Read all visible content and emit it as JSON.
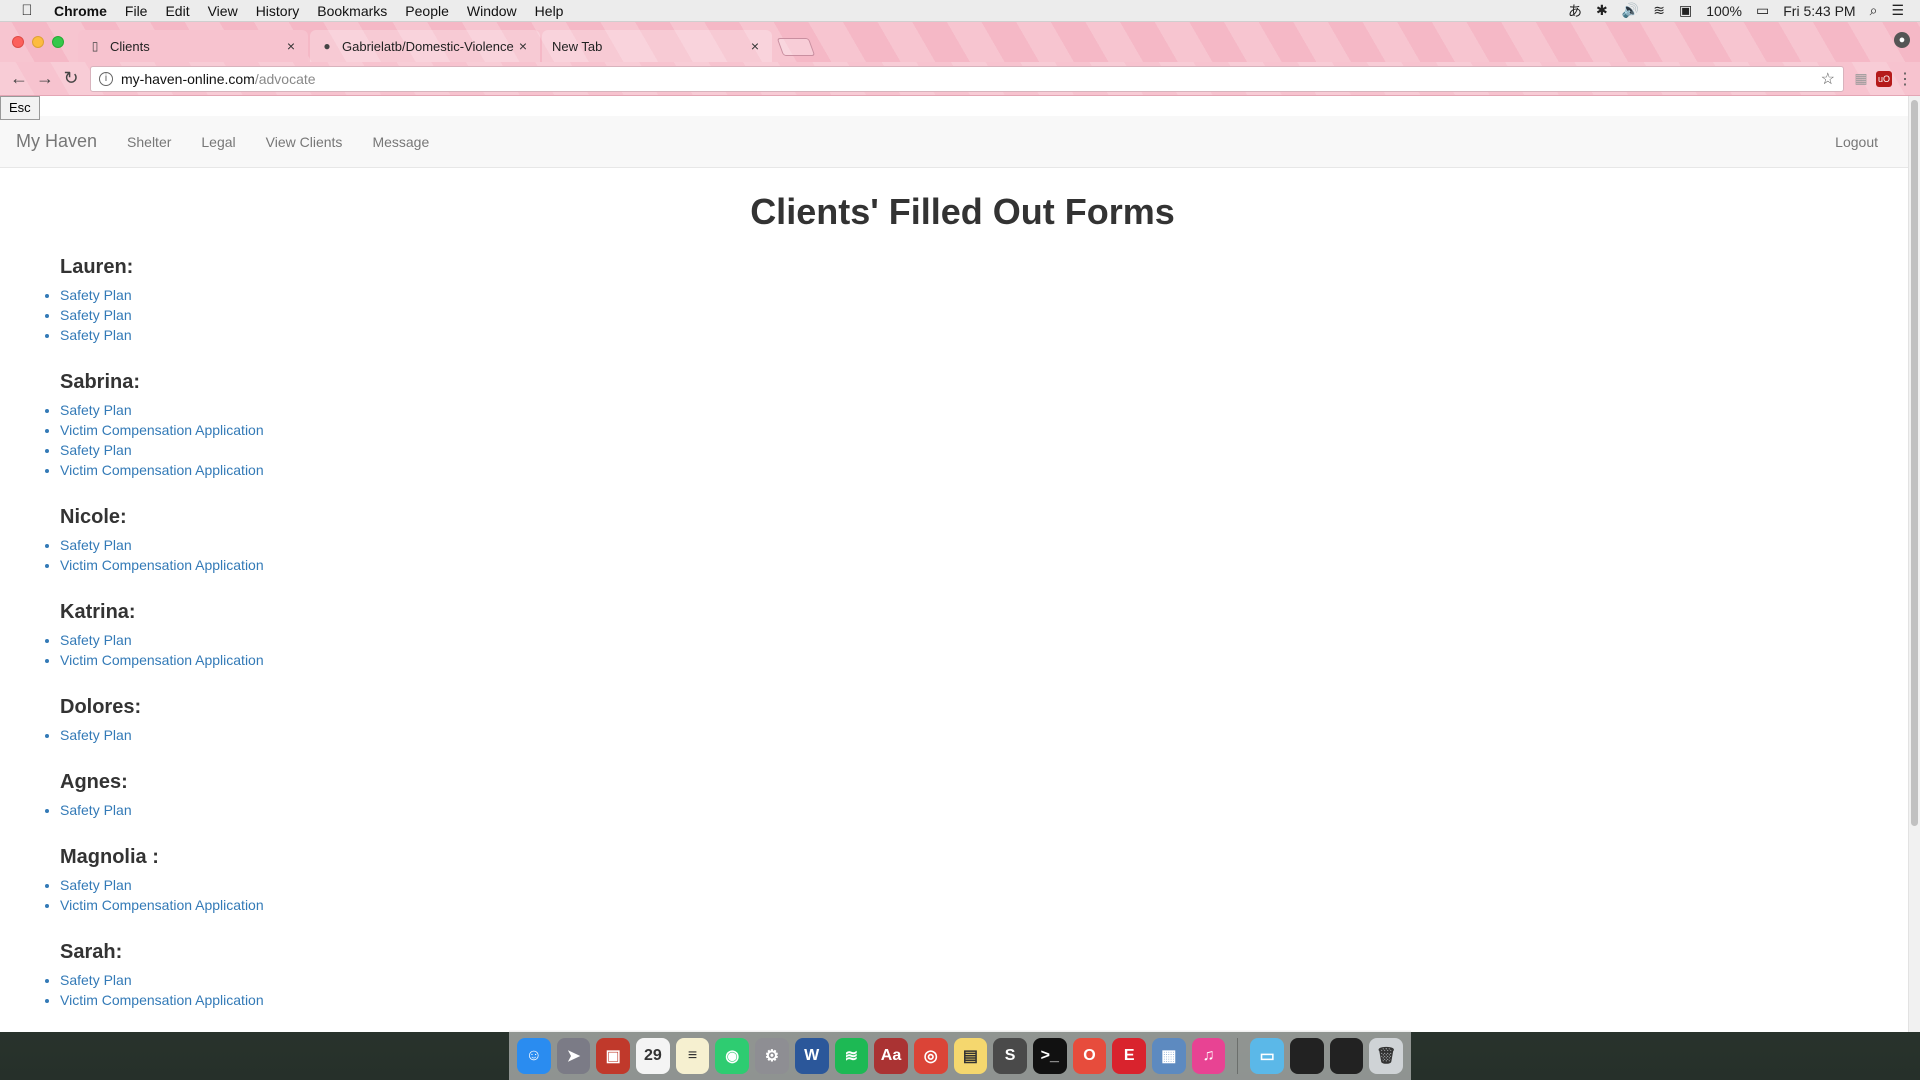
{
  "menubar": {
    "app": "Chrome",
    "items": [
      "File",
      "Edit",
      "View",
      "History",
      "Bookmarks",
      "People",
      "Window",
      "Help"
    ],
    "battery": "100%",
    "clock": "Fri 5:43 PM"
  },
  "browser": {
    "tabs": [
      {
        "title": "Clients",
        "favicon": "page-icon"
      },
      {
        "title": "Gabrielatb/Domestic-Violence",
        "favicon": "github-icon"
      },
      {
        "title": "New Tab",
        "favicon": ""
      }
    ],
    "url_host": "my-haven-online.com",
    "url_path": "/advocate"
  },
  "page": {
    "esc_label": "Esc",
    "brand": "My Haven",
    "nav": [
      "Shelter",
      "Legal",
      "View Clients",
      "Message"
    ],
    "logout": "Logout",
    "heading": "Clients' Filled Out Forms",
    "clients": [
      {
        "name": "Lauren:",
        "forms": [
          "Safety Plan",
          "Safety Plan",
          "Safety Plan"
        ]
      },
      {
        "name": "Sabrina:",
        "forms": [
          "Safety Plan",
          "Victim Compensation Application",
          "Safety Plan",
          "Victim Compensation Application"
        ]
      },
      {
        "name": "Nicole:",
        "forms": [
          "Safety Plan",
          "Victim Compensation Application"
        ]
      },
      {
        "name": "Katrina:",
        "forms": [
          "Safety Plan",
          "Victim Compensation Application"
        ]
      },
      {
        "name": "Dolores:",
        "forms": [
          "Safety Plan"
        ]
      },
      {
        "name": "Agnes:",
        "forms": [
          "Safety Plan"
        ]
      },
      {
        "name": "Magnolia :",
        "forms": [
          "Safety Plan",
          "Victim Compensation Application"
        ]
      },
      {
        "name": "Sarah:",
        "forms": [
          "Safety Plan",
          "Victim Compensation Application"
        ]
      }
    ]
  },
  "dock": {
    "apps": [
      {
        "name": "finder-icon",
        "color": "#2a8cf0",
        "glyph": "☺"
      },
      {
        "name": "launchpad-icon",
        "color": "#7b7b86",
        "glyph": "➤"
      },
      {
        "name": "photo-booth-icon",
        "color": "#c0392b",
        "glyph": "▣"
      },
      {
        "name": "calendar-icon",
        "color": "#f4f4f4",
        "glyph": "29"
      },
      {
        "name": "notes-icon",
        "color": "#f6f0d0",
        "glyph": "≡"
      },
      {
        "name": "facetime-icon",
        "color": "#2ecc71",
        "glyph": "◉"
      },
      {
        "name": "system-preferences-icon",
        "color": "#8e8e93",
        "glyph": "⚙"
      },
      {
        "name": "word-icon",
        "color": "#2b579a",
        "glyph": "W"
      },
      {
        "name": "spotify-icon",
        "color": "#1db954",
        "glyph": "≋"
      },
      {
        "name": "dictionary-icon",
        "color": "#a33",
        "glyph": "Aa"
      },
      {
        "name": "chrome-icon",
        "color": "#db4437",
        "glyph": "◎"
      },
      {
        "name": "stickies-icon",
        "color": "#f5d76e",
        "glyph": "▤"
      },
      {
        "name": "sublime-text-icon",
        "color": "#4a4a4a",
        "glyph": "S"
      },
      {
        "name": "terminal-icon",
        "color": "#111",
        "glyph": ">_"
      },
      {
        "name": "office-icon",
        "color": "#e74c3c",
        "glyph": "O"
      },
      {
        "name": "evernote-icon",
        "color": "#d9232d",
        "glyph": "E"
      },
      {
        "name": "preview-icon",
        "color": "#5d8ac0",
        "glyph": "▦"
      },
      {
        "name": "itunes-icon",
        "color": "#e84393",
        "glyph": "♫"
      },
      {
        "name": "folder-icon",
        "color": "#5bb8e8",
        "glyph": "▭"
      },
      {
        "name": "window-thumb-icon",
        "color": "#222",
        "glyph": ""
      },
      {
        "name": "window-thumb-icon",
        "color": "#222",
        "glyph": ""
      },
      {
        "name": "trash-icon",
        "color": "#cfd3d6",
        "glyph": "🗑"
      }
    ]
  }
}
